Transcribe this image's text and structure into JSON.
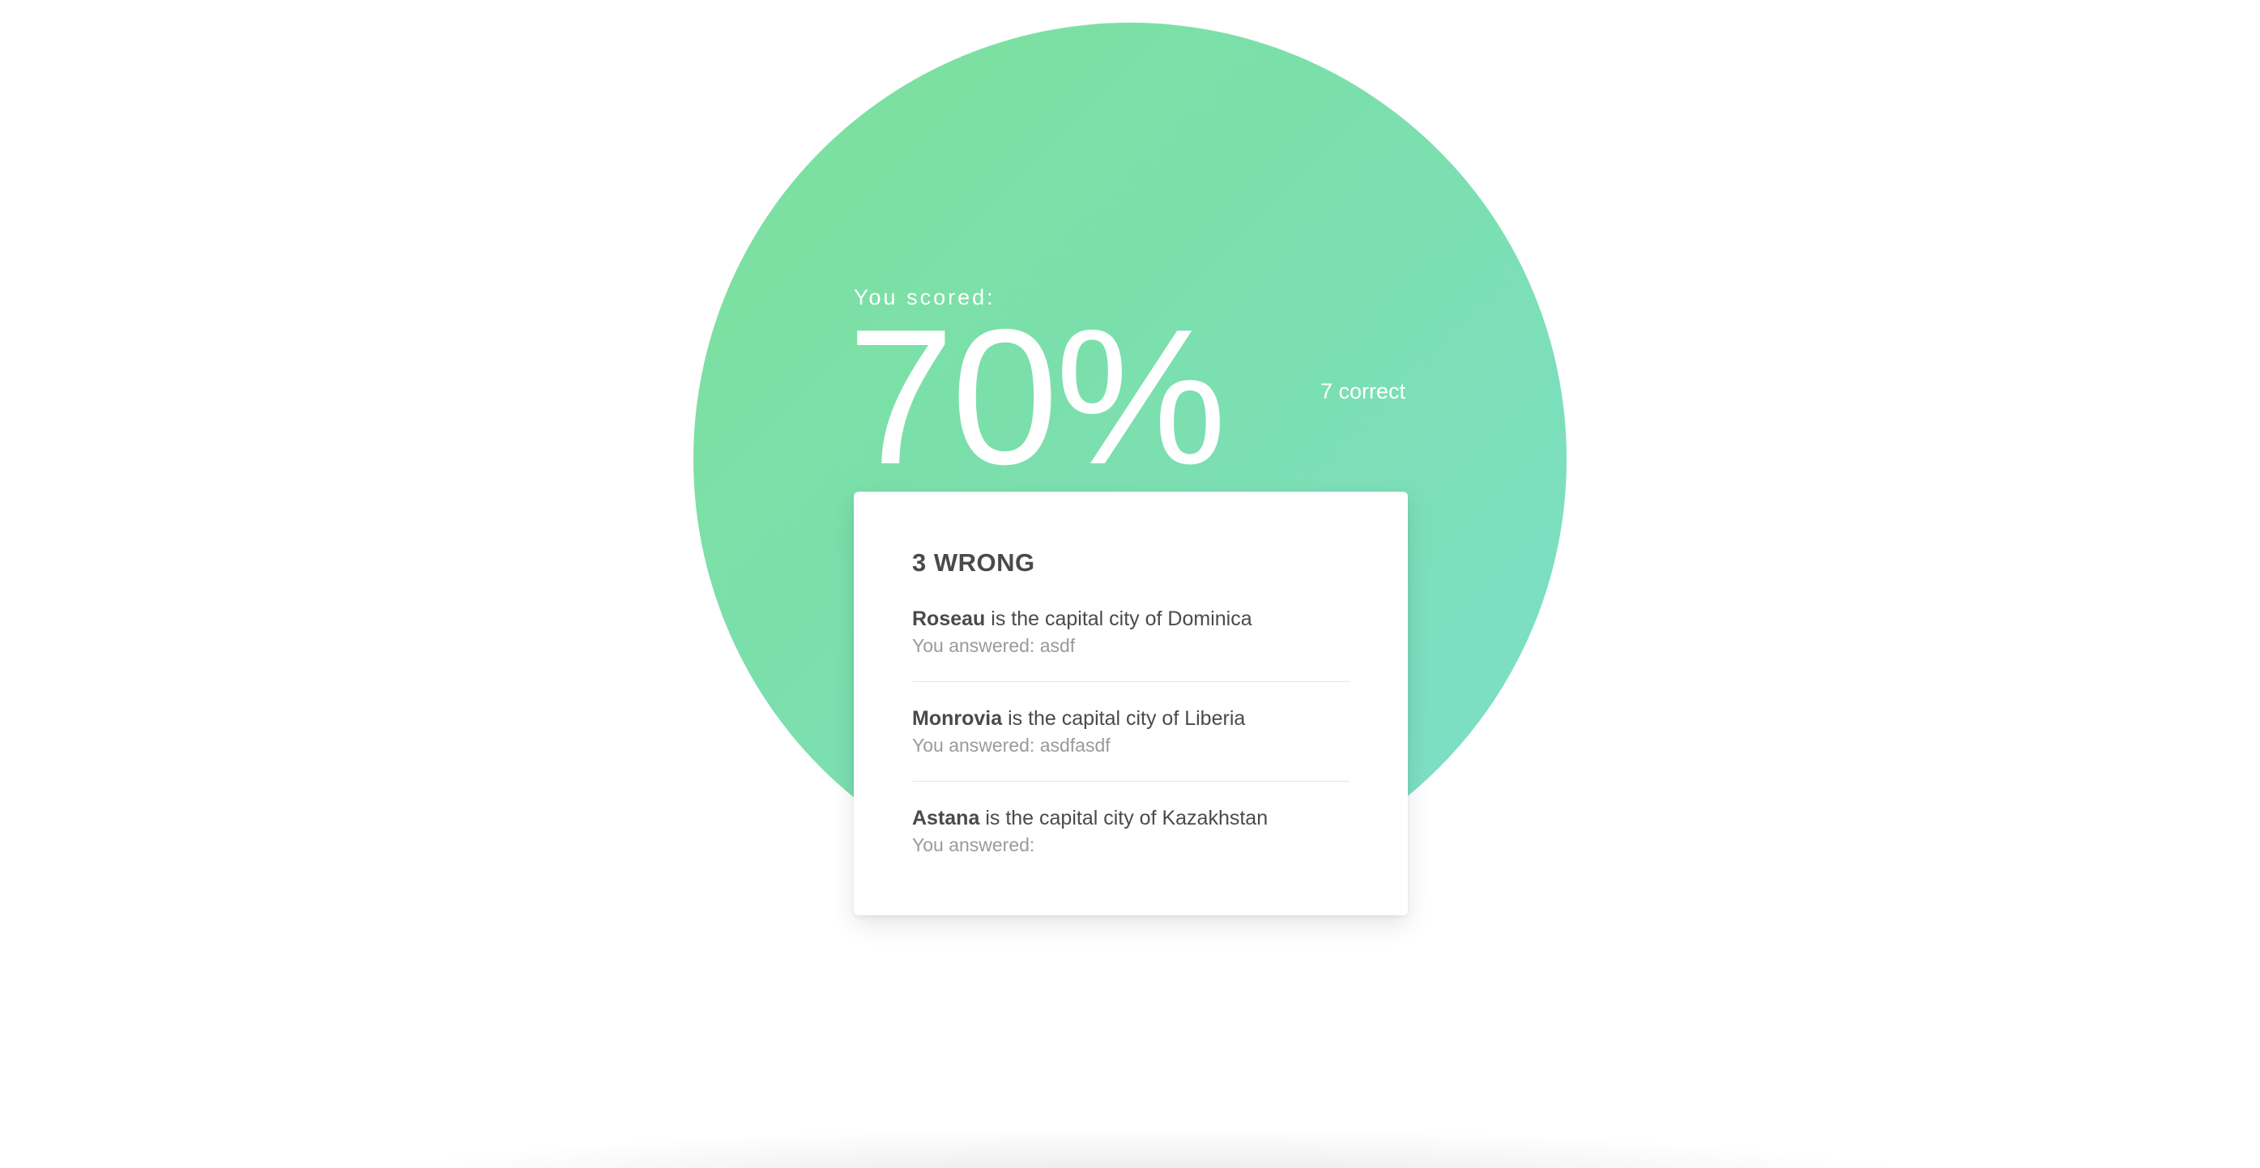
{
  "score": {
    "label": "You scored:",
    "percent": "70%",
    "correct_text": "7 correct",
    "circle_color": "#7ce09b"
  },
  "wrong": {
    "heading": "3 WRONG",
    "items": [
      {
        "answer": "Roseau",
        "question_rest": " is the capital city of Dominica",
        "answered": "You answered: asdf"
      },
      {
        "answer": "Monrovia",
        "question_rest": " is the capital city of Liberia",
        "answered": "You answered: asdfasdf"
      },
      {
        "answer": "Astana",
        "question_rest": " is the capital city of Kazakhstan",
        "answered": "You answered:"
      }
    ]
  }
}
